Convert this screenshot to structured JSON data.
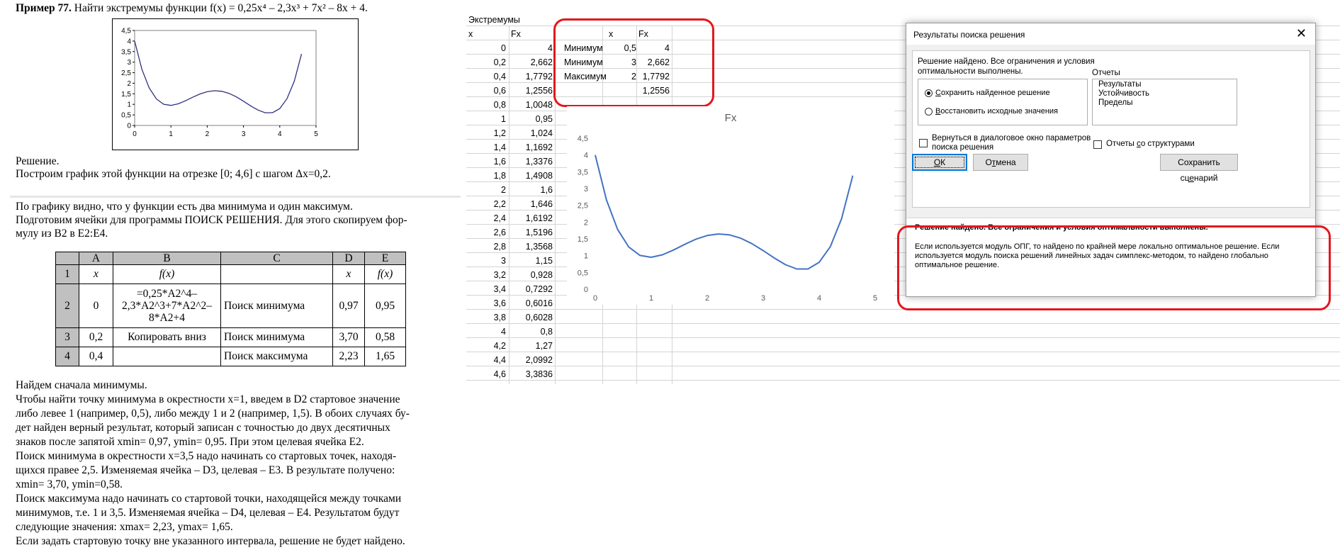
{
  "doc": {
    "example_label": "Пример 77.",
    "task": "Найти экстремумы функции f(x) = 0,25x⁴ – 2,3x³ + 7x² – 8x + 4.",
    "figure": {
      "y_ticks": [
        "4,5",
        "4",
        "3,5",
        "3",
        "2,5",
        "2",
        "1,5",
        "1",
        "0,5",
        "0"
      ],
      "x_ticks": [
        "0",
        "1",
        "2",
        "3",
        "4",
        "5"
      ]
    },
    "solution_heading": "Решение.",
    "solution_line": "Построим график этой функции на отрезке [0; 4,6] с шагом Δx=0,2.",
    "para1": [
      "По графику видно, что у функции есть два минимума и один максимум.",
      "Подготовим ячейки для программы ПОИСК РЕШЕНИЯ. Для этого скопируем фор-",
      "мулу из B2 в E2:E4."
    ],
    "table": {
      "col_headers": [
        "A",
        "B",
        "C",
        "D",
        "E"
      ],
      "row1": [
        "1",
        "x",
        "f(x)",
        "",
        "x",
        "f(x)"
      ],
      "row2": {
        "rn": "2",
        "a": "0",
        "b_lines": [
          "=0,25*A2^4–",
          "2,3*A2^3+7*A2^2–",
          "8*A2+4"
        ],
        "c": "Поиск минимума",
        "d": "0,97",
        "e": "0,95"
      },
      "row3": {
        "rn": "3",
        "a": "0,2",
        "b": "Копировать вниз",
        "c": "Поиск минимума",
        "d": "3,70",
        "e": "0,58"
      },
      "row4": {
        "rn": "4",
        "a": "0,4",
        "b": "",
        "c": "Поиск максимума",
        "d": "2,23",
        "e": "1,65"
      }
    },
    "para2": [
      "Найдем сначала минимумы.",
      "Чтобы найти точку минимума в окрестности x=1, введем в D2 стартовое значение",
      "либо левее 1 (например, 0,5), либо между 1 и 2 (например, 1,5). В обоих случаях бу-",
      "дет найден верный результат, который записан с точностью до двух десятичных",
      "знаков после запятой xmin= 0,97, ymin= 0,95. При этом целевая ячейка E2.",
      "Поиск минимума в окрестности x=3,5 надо начинать со стартовых точек, находя-",
      "щихся правее 2,5. Изменяемая ячейка – D3, целевая – E3. В результате получено:",
      "xmin= 3,70, ymin=0,58.",
      "Поиск максимума надо начинать со стартовой точки, находящейся между точками",
      "минимумов, т.е. 1 и 3,5. Изменяемая ячейка – D4, целевая – E4. Результатом будут",
      "следующие значения: xmax= 2,23, ymax= 1,65.",
      "Если задать стартовую точку вне указанного интервала, решение не будет найдено."
    ]
  },
  "sheet": {
    "title": "Экстремумы",
    "header_x": "x",
    "header_fx": "Fx",
    "xs": [
      "0",
      "0,2",
      "0,4",
      "0,6",
      "0,8",
      "1",
      "1,2",
      "1,4",
      "1,6",
      "1,8",
      "2",
      "2,2",
      "2,4",
      "2,6",
      "2,8",
      "3",
      "3,2",
      "3,4",
      "3,6",
      "3,8",
      "4",
      "4,2",
      "4,4",
      "4,6"
    ],
    "fxs": [
      "4",
      "2,662",
      "1,7792",
      "1,2556",
      "1,0048",
      "0,95",
      "1,024",
      "1,1692",
      "1,3376",
      "1,4908",
      "1,6",
      "1,646",
      "1,6192",
      "1,5196",
      "1,3568",
      "1,15",
      "0,928",
      "0,7292",
      "0,6016",
      "0,6028",
      "0,8",
      "1,27",
      "2,0992",
      "3,3836"
    ],
    "extrema": {
      "header_x": "x",
      "header_fx": "Fx",
      "rows": [
        {
          "label": "Минимум",
          "x": "0,5",
          "fx": "4"
        },
        {
          "label": "Минимум",
          "x": "3",
          "fx": "2,662"
        },
        {
          "label": "Максимум",
          "x": "2",
          "fx": "1,7792"
        },
        {
          "label": "",
          "x": "",
          "fx": "1,2556"
        }
      ]
    }
  },
  "chart_data": {
    "type": "line",
    "title": "Fx",
    "x": [
      0,
      0.2,
      0.4,
      0.6,
      0.8,
      1,
      1.2,
      1.4,
      1.6,
      1.8,
      2,
      2.2,
      2.4,
      2.6,
      2.8,
      3,
      3.2,
      3.4,
      3.6,
      3.8,
      4,
      4.2,
      4.4,
      4.6
    ],
    "series": [
      {
        "values": [
          4,
          2.662,
          1.7792,
          1.2556,
          1.0048,
          0.95,
          1.024,
          1.1692,
          1.3376,
          1.4908,
          1.6,
          1.646,
          1.6192,
          1.5196,
          1.3568,
          1.15,
          0.928,
          0.7292,
          0.6016,
          0.6028,
          0.8,
          1.27,
          2.0992,
          3.3836
        ]
      }
    ],
    "xlim": [
      0,
      5
    ],
    "ylim": [
      0,
      4.5
    ],
    "x_ticks": [
      "0",
      "1",
      "2",
      "3",
      "4",
      "5"
    ],
    "y_ticks": [
      "4,5",
      "4",
      "3,5",
      "3",
      "2,5",
      "2",
      "1,5",
      "1",
      "0,5",
      "0"
    ],
    "line_color": "#4472c4",
    "grid": false
  },
  "dialog": {
    "title": "Результаты поиска решения",
    "close_glyph": "✕",
    "status_lines": [
      "Решение найдено. Все ограничения и условия",
      "оптимальности выполнены."
    ],
    "radio_keep": {
      "u": "С",
      "rest": "охранить найденное решение"
    },
    "radio_restore": {
      "u": "В",
      "rest": "осстановить исходные значения"
    },
    "reports_label": "Отчеты",
    "reports": [
      "Результаты",
      "Устойчивость",
      "Пределы"
    ],
    "checkbox_return": [
      "Вернуться в диалоговое окно параметров",
      "поиска решения"
    ],
    "checkbox_outline": {
      "pre": "Отчеты ",
      "u": "с",
      "rest": "о структурами"
    },
    "ok": {
      "u": "О",
      "rest": "К"
    },
    "cancel": {
      "pre": "О",
      "u": "т",
      "rest": "мена"
    },
    "save_scenario": {
      "pre": "Сохранить сц",
      "u": "е",
      "rest": "нарий"
    },
    "summary_bold": "Решение найдено. Все ограничения и условия оптимальности выполнены.",
    "summary_detail": [
      "Если используется модуль ОПГ, то найдено по крайней мере локально оптимальное решение. Если",
      "используется модуль поиска решений линейных задач симплекс-методом, то найдено глобально",
      "оптимальное решение."
    ]
  },
  "colors": {
    "highlight": "#e3171d",
    "chart_line": "#4472c4",
    "doc_curve": "#2f2f7f"
  }
}
